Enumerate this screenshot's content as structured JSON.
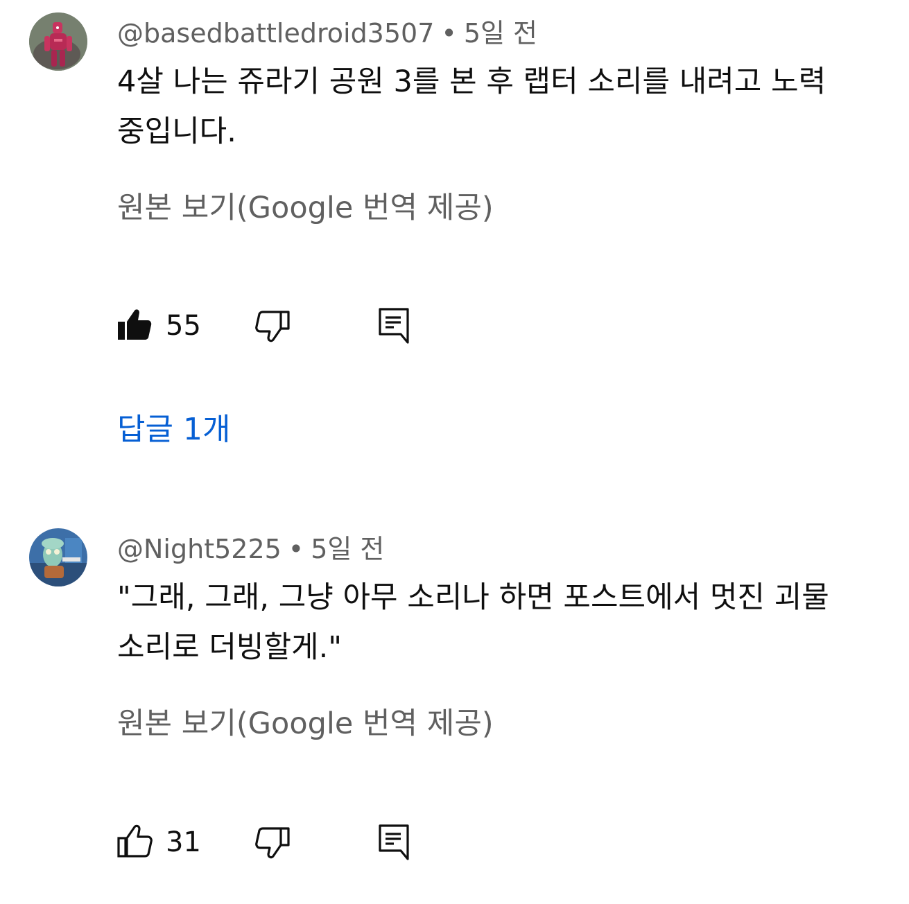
{
  "comments": [
    {
      "author": "@basedbattledroid3507",
      "separator": "•",
      "time": "5일 전",
      "text_line1": "4살 나는 쥬라기 공원 3를 본 후 랩터 소리를 내려고 노력",
      "text_line2": "중입니다.",
      "translate_label": "원본 보기(Google 번역 제공)",
      "likes": "55",
      "liked": true,
      "replies_label": "답글 1개",
      "avatar_icon": "robot-avatar"
    },
    {
      "author": "@Night5225",
      "separator": "•",
      "time": "5일 전",
      "text_line1": "\"그래, 그래, 그냥 아무 소리나 하면 포스트에서 멋진 괴물",
      "text_line2": "소리로 더빙할게.\"",
      "translate_label": "원본 보기(Google 번역 제공)",
      "likes": "31",
      "liked": false,
      "avatar_icon": "cartoon-avatar"
    }
  ],
  "colors": {
    "link_blue": "#065fd4",
    "secondary_text": "#606060",
    "primary_text": "#0f0f0f"
  }
}
